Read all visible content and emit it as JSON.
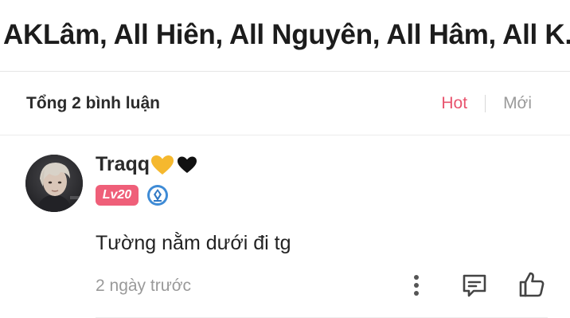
{
  "title": "AKLâm, All Hiên, All Nguyên, All Hâm, All K...",
  "comments_header": {
    "total_label": "Tổng 2 bình luận",
    "sort_hot": "Hot",
    "sort_new": "Mới",
    "active_sort": "Hot"
  },
  "comment": {
    "username": "Traqq",
    "level": "Lv20",
    "text": "Tường nằm dưới đi tg",
    "time": "2 ngày trước"
  },
  "colors": {
    "accent": "#e8546e",
    "level_badge": "#ef5f79",
    "muted": "#9a9a9a"
  },
  "icons": [
    "yellow-heart-icon",
    "black-heart-icon",
    "vip-badge-icon",
    "more-options-icon",
    "reply-icon",
    "like-icon"
  ]
}
